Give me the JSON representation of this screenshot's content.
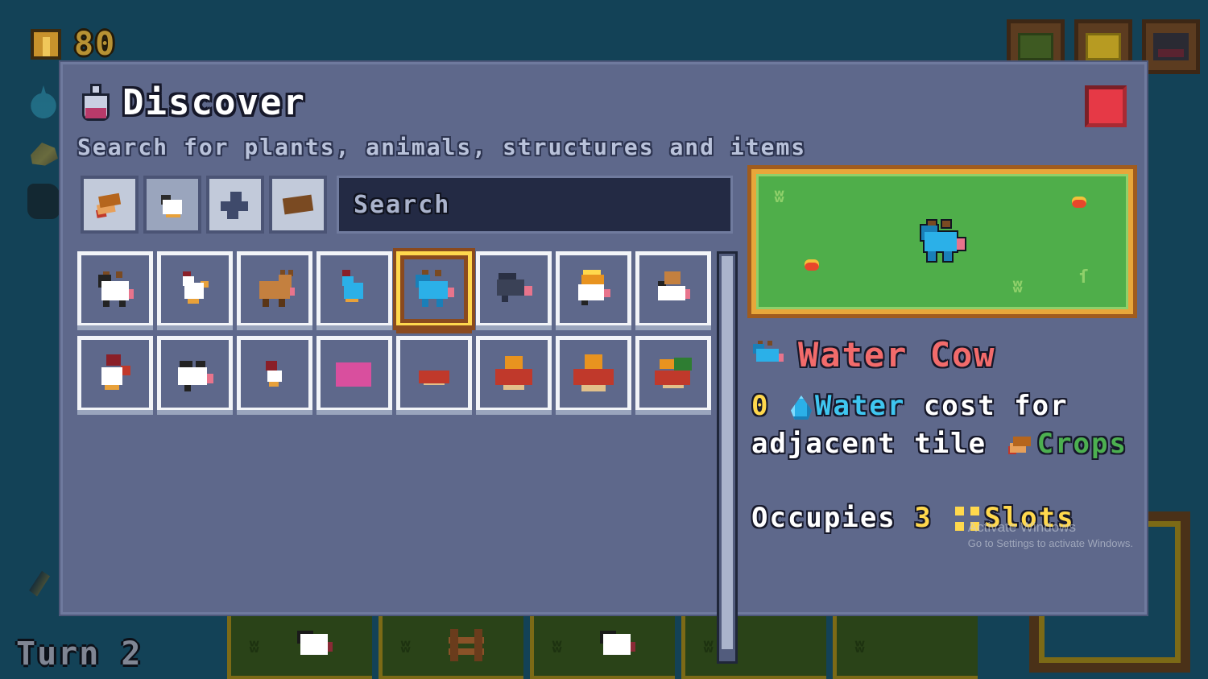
{
  "hud": {
    "coin_count": "80",
    "turn_label": "Turn 2",
    "coin_icon": "coin-icon",
    "rail_icons": [
      "water-drop-icon",
      "crop-icon",
      "coal-icon"
    ],
    "rail_bottom_icon": "pickaxe-icon",
    "buttons": [
      {
        "name": "book-button",
        "icon": "green-book-icon"
      },
      {
        "name": "chest-button",
        "icon": "gold-chest-icon"
      },
      {
        "name": "tools-button",
        "icon": "tools-icon"
      }
    ],
    "hotbar_tiles": [
      {
        "name": "tile-cow",
        "sprite": "cow-sprite",
        "grass": "ʬ"
      },
      {
        "name": "tile-fence",
        "sprite": "fence-sprite",
        "grass": "ʬ"
      },
      {
        "name": "tile-cow-2",
        "sprite": "cow-sprite",
        "grass": "ʬ"
      },
      {
        "name": "tile-empty",
        "sprite": "",
        "grass": "ʬ"
      },
      {
        "name": "tile-empty-2",
        "sprite": "",
        "grass": "ʬ"
      }
    ]
  },
  "modal": {
    "title": "Discover",
    "title_icon": "flask-icon",
    "subtitle": "Search for plants, animals, structures and items",
    "close_label": "",
    "filters": [
      {
        "name": "filter-plants",
        "icon": "crop-icon",
        "active": false
      },
      {
        "name": "filter-animals",
        "icon": "animal-icon",
        "active": true
      },
      {
        "name": "filter-structures",
        "icon": "structure-icon",
        "active": false
      },
      {
        "name": "filter-items",
        "icon": "wood-log-icon",
        "active": false
      }
    ],
    "search": {
      "value": "",
      "placeholder": "Search"
    },
    "grid": [
      {
        "name": "item-cow",
        "sprite": "s-cow",
        "selected": false
      },
      {
        "name": "item-chicken",
        "sprite": "s-chicken",
        "selected": false
      },
      {
        "name": "item-goat",
        "sprite": "s-goat",
        "selected": false
      },
      {
        "name": "item-blue-chicken",
        "sprite": "s-bluechick",
        "selected": false
      },
      {
        "name": "item-water-cow",
        "sprite": "s-watercow",
        "selected": true
      },
      {
        "name": "item-dark-cow",
        "sprite": "s-darkcow",
        "selected": false
      },
      {
        "name": "item-crown-cow",
        "sprite": "s-crowncow",
        "selected": false
      },
      {
        "name": "item-bull-cow",
        "sprite": "s-bullcow",
        "selected": false
      },
      {
        "name": "item-rooster",
        "sprite": "s-roost",
        "selected": false
      },
      {
        "name": "item-spotted-cow",
        "sprite": "s-spotcow",
        "selected": false
      },
      {
        "name": "item-chick",
        "sprite": "s-chick",
        "selected": false
      },
      {
        "name": "item-pig",
        "sprite": "s-pig",
        "selected": false
      },
      {
        "name": "item-crab-small",
        "sprite": "s-crabsm",
        "selected": false
      },
      {
        "name": "item-crab-medium",
        "sprite": "s-crabmed",
        "selected": false
      },
      {
        "name": "item-crab-large",
        "sprite": "s-crabbig",
        "selected": false
      },
      {
        "name": "item-crab-green",
        "sprite": "s-crabgreen",
        "selected": false
      }
    ],
    "detail": {
      "preview_icon": "water-cow-preview",
      "name": "Water Cow",
      "name_icon": "water-cow-icon",
      "desc_cost": "0",
      "desc_water_word": "Water",
      "desc_mid": "cost for",
      "desc_line2": "adjacent tile",
      "desc_crops_word": "Crops",
      "slots_prefix": "Occupies",
      "slots_count": "3",
      "slots_word": "Slots"
    }
  },
  "watermark": {
    "title": "Activate Windows",
    "subtitle": "Go to Settings to activate Windows."
  },
  "colors": {
    "panel_bg": "#5e688b",
    "accent_gold": "#ffd84d",
    "name_red": "#f26b6b",
    "water_blue": "#3fc6f0",
    "crops_green": "#4caf50",
    "close_red": "#e63946",
    "preview_green": "#4fae4a"
  }
}
